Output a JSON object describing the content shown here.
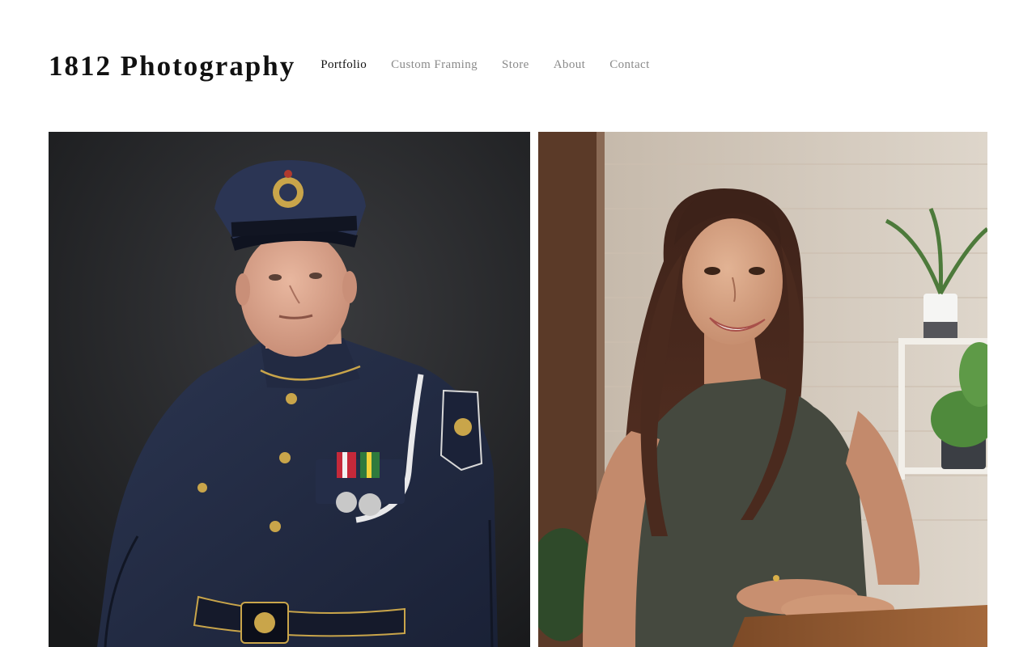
{
  "site": {
    "title": "1812 Photography"
  },
  "nav": {
    "items": [
      {
        "label": "Portfolio",
        "active": true
      },
      {
        "label": "Custom Framing",
        "active": false
      },
      {
        "label": "Store",
        "active": false
      },
      {
        "label": "About",
        "active": false
      },
      {
        "label": "Contact",
        "active": false
      }
    ]
  },
  "gallery": {
    "photos": [
      {
        "subject": "portrait-uniformed-officer"
      },
      {
        "subject": "portrait-smiling-woman"
      }
    ]
  },
  "colors": {
    "text_active": "#111111",
    "text_muted": "#8a8a8a",
    "background": "#ffffff"
  }
}
